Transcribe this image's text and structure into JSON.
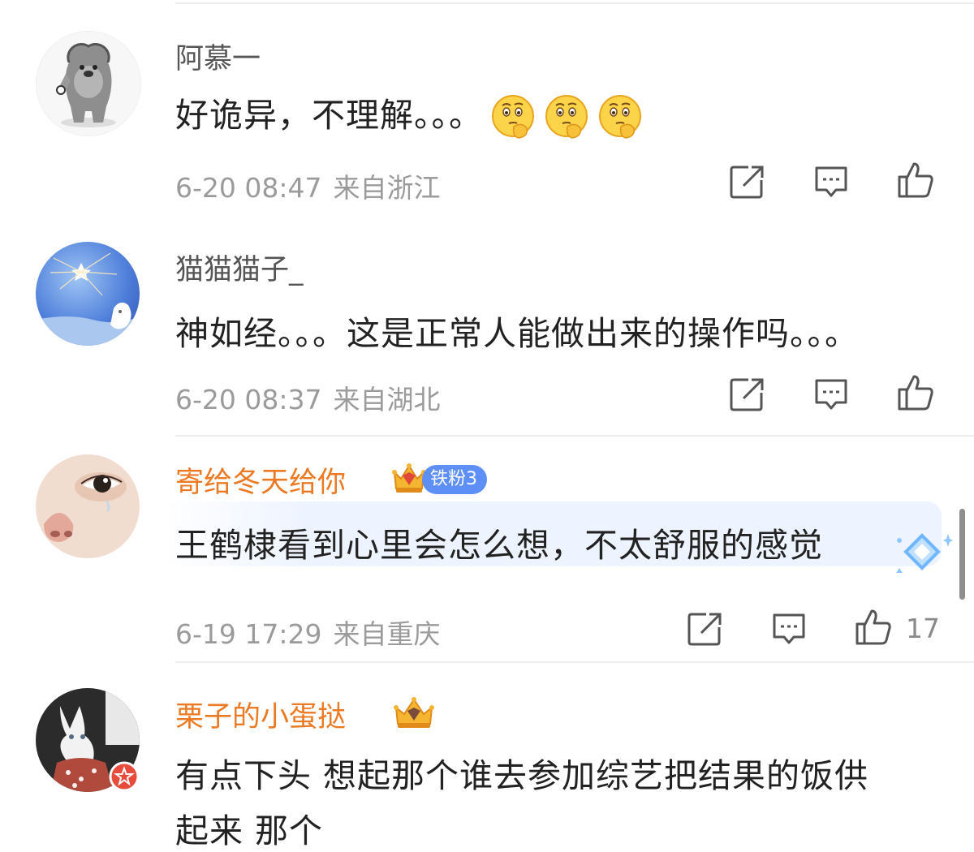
{
  "comments": [
    {
      "username": "阿慕一",
      "text": "好诡异，不理解。。。",
      "emoji_count": 3,
      "date": "6-20 08:47",
      "location": "来自浙江",
      "likes": ""
    },
    {
      "username": "猫猫猫子_",
      "text": "神如经。。。这是正常人能做出来的操作吗。。。",
      "date": "6-20 08:37",
      "location": "来自湖北",
      "likes": ""
    },
    {
      "username": "寄给冬天给你",
      "badge": "铁粉3",
      "text": "王鹤棣看到心里会怎么想，不太舒服的感觉",
      "date": "6-19 17:29",
      "location": "来自重庆",
      "likes": "17"
    },
    {
      "username": "栗子的小蛋挞",
      "text_line1": "有点下头 想起那个谁去参加综艺把结果的饭供",
      "text_line2": "起来 那个"
    }
  ],
  "colors": {
    "username_default": "#555555",
    "username_vip": "#ec7a25",
    "meta": "#9b9b9b",
    "fan_badge": "#5d8ff7",
    "icon_stroke": "#555555"
  },
  "icons": [
    "repost-icon",
    "comment-icon",
    "like-icon",
    "thinking-face-emoji-icon",
    "crown-badge-icon",
    "verified-badge-icon"
  ]
}
